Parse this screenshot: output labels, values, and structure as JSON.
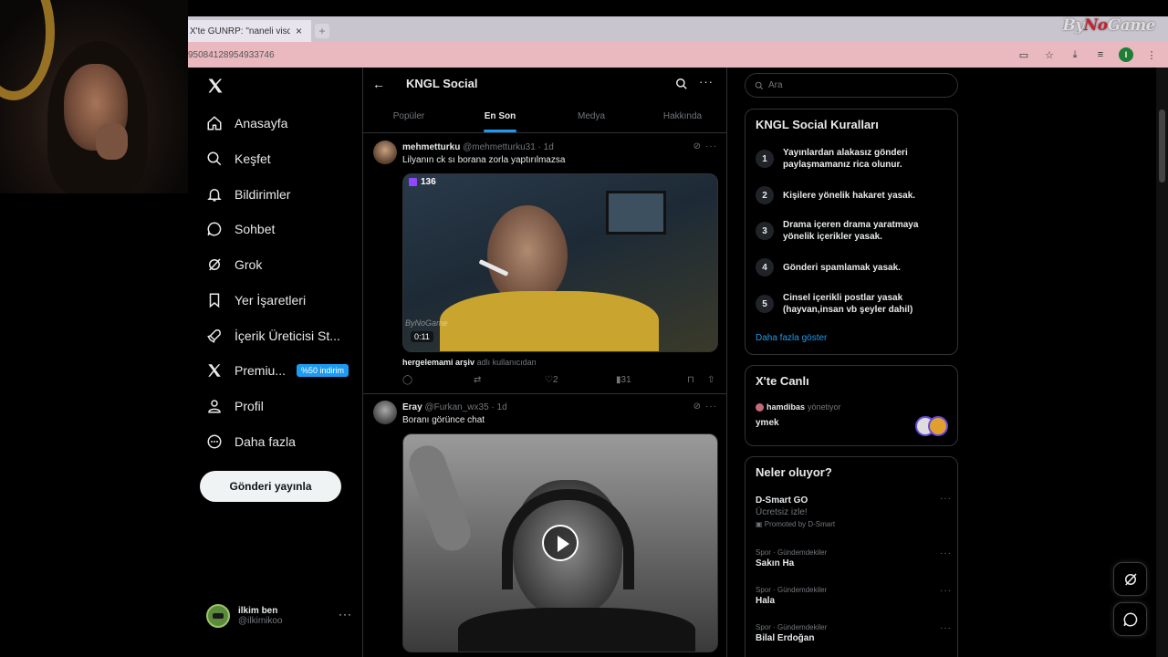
{
  "browser": {
    "tab_title": "X'te GUNRP: \"naneli visq... https:",
    "tab_close": "×",
    "new_tab": "+",
    "url": "95084128954933746",
    "brand_left": "By",
    "brand_mark": "No",
    "brand_right": "Game",
    "profile_initial": "I"
  },
  "sidebar": {
    "items": [
      {
        "label": "Anasayfa",
        "icon": "home-icon"
      },
      {
        "label": "Keşfet",
        "icon": "search-icon"
      },
      {
        "label": "Bildirimler",
        "icon": "bell-icon"
      },
      {
        "label": "Sohbet",
        "icon": "chat-icon"
      },
      {
        "label": "Grok",
        "icon": "grok-icon"
      },
      {
        "label": "Yer İşaretleri",
        "icon": "bookmark-icon"
      },
      {
        "label": "İçerik Üreticisi St...",
        "icon": "rocket-icon"
      },
      {
        "label": "Premiu...",
        "icon": "x-icon",
        "badge": "%50 indirim"
      },
      {
        "label": "Profil",
        "icon": "person-icon"
      },
      {
        "label": "Daha fazla",
        "icon": "more-circle-icon"
      }
    ],
    "post_button": "Gönderi yayınla",
    "account": {
      "name": "ilkim ben",
      "handle": "@ilkimikoo",
      "more": "···"
    }
  },
  "main": {
    "title": "KNGL Social",
    "back": "←",
    "more": "···",
    "tabs": [
      "Popüler",
      "En Son",
      "Medya",
      "Hakkında"
    ],
    "active_tab": "En Son",
    "posts": [
      {
        "name": "mehmetturku",
        "handle": "@mehmetturku31 · 1d",
        "text": "Lilyanın ck sı borana zorla yaptırılmazsa",
        "media_badge": "136",
        "media_watermark": "ByNoGame",
        "duration": "0:11",
        "from_user_name": "hergelemami arşiv",
        "from_user_suffix": "adlı kullanıcıdan",
        "likes": "2",
        "views": "31"
      },
      {
        "name": "Eray",
        "handle": "@Furkan_wx35 · 1d",
        "text": "Boranı görünce chat"
      }
    ]
  },
  "right": {
    "search_placeholder": "Ara",
    "rules": {
      "title": "KNGL Social Kuralları",
      "items": [
        {
          "num": "1",
          "text": "Yayınlardan alakasız gönderi paylaşmamanız rica olunur."
        },
        {
          "num": "2",
          "text": "Kişilere yönelik hakaret yasak."
        },
        {
          "num": "3",
          "text": "Drama içeren drama yaratmaya yönelik içerikler yasak."
        },
        {
          "num": "4",
          "text": "Gönderi spamlamak yasak."
        },
        {
          "num": "5",
          "text": "Cinsel içerikli postlar yasak (hayvan,insan vb şeyler dahil)"
        }
      ],
      "show_more": "Daha fazla göster"
    },
    "live": {
      "title": "X'te Canlı",
      "host": "hamdibas",
      "host_suffix": "yönetiyor",
      "space_title": "ymek"
    },
    "trends": {
      "title": "Neler oluyor?",
      "items": [
        {
          "meta": "",
          "name": "D-Smart GO",
          "sub": "Ücretsiz izle!",
          "promo": "Promoted by D-Smart"
        },
        {
          "meta": "Spor · Gündemdekiler",
          "name": "Sakın Ha",
          "sub": "",
          "promo": ""
        },
        {
          "meta": "Spor · Gündemdekiler",
          "name": "Hala",
          "sub": "",
          "promo": ""
        },
        {
          "meta": "Spor · Gündemdekiler",
          "name": "Bilal Erdoğan",
          "sub": "",
          "promo": ""
        }
      ],
      "more": "···"
    }
  },
  "colors": {
    "accent": "#1d9bf0",
    "border": "#2f3336",
    "muted": "#71767b",
    "text": "#e7e9ea"
  }
}
